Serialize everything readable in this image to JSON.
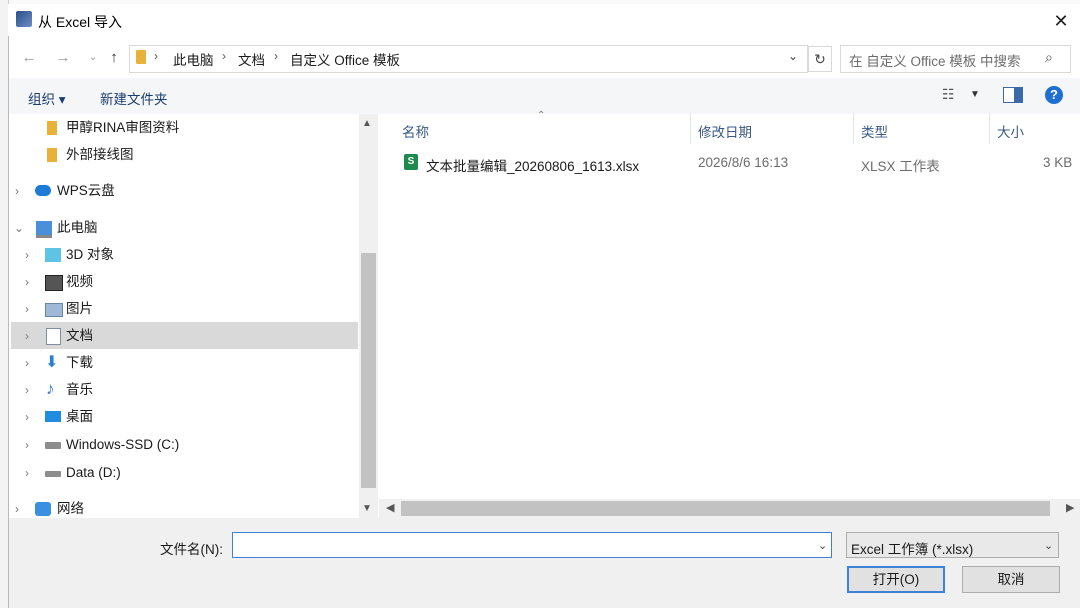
{
  "window": {
    "title": "从 Excel 导入"
  },
  "address": {
    "crumbs": [
      "此电脑",
      "文档",
      "自定义 Office 模板"
    ],
    "separator": "›"
  },
  "search": {
    "placeholder": "在 自定义 Office 模板 中搜索"
  },
  "toolbar": {
    "organize_label": "组织 ▾",
    "new_folder_label": "新建文件夹"
  },
  "nav": {
    "items": [
      {
        "label": "甲醇RINA审图资料",
        "icon": "folder-icon"
      },
      {
        "label": "外部接线图",
        "icon": "folder-icon"
      },
      {
        "label": "WPS云盘",
        "icon": "cloud-icon"
      },
      {
        "label": "此电脑",
        "icon": "computer-icon"
      },
      {
        "label": "3D 对象",
        "icon": "cube-icon"
      },
      {
        "label": "视频",
        "icon": "video-icon"
      },
      {
        "label": "图片",
        "icon": "pictures-icon"
      },
      {
        "label": "文档",
        "icon": "documents-icon"
      },
      {
        "label": "下载",
        "icon": "download-icon"
      },
      {
        "label": "音乐",
        "icon": "music-icon"
      },
      {
        "label": "桌面",
        "icon": "desktop-icon"
      },
      {
        "label": "Windows-SSD (C:)",
        "icon": "drive-icon"
      },
      {
        "label": "Data (D:)",
        "icon": "drive-icon"
      },
      {
        "label": "网络",
        "icon": "network-icon"
      }
    ],
    "selected": "文档"
  },
  "columns": {
    "name": "名称",
    "modified": "修改日期",
    "type": "类型",
    "size": "大小"
  },
  "files": [
    {
      "name": "文本批量编辑_20260806_1613.xlsx",
      "modified": "2026/8/6 16:13",
      "type": "XLSX 工作表",
      "size": "3 KB",
      "icon_letter": "S"
    }
  ],
  "bottom": {
    "filename_label": "文件名(N):",
    "filename_value": "",
    "filetype_label": "Excel 工作簿 (*.xlsx)",
    "open_label": "打开(O)",
    "cancel_label": "取消"
  },
  "colors": {
    "accent": "#3d82d6",
    "selected_bg": "#d9d9d9",
    "link": "#1a3e6e"
  }
}
